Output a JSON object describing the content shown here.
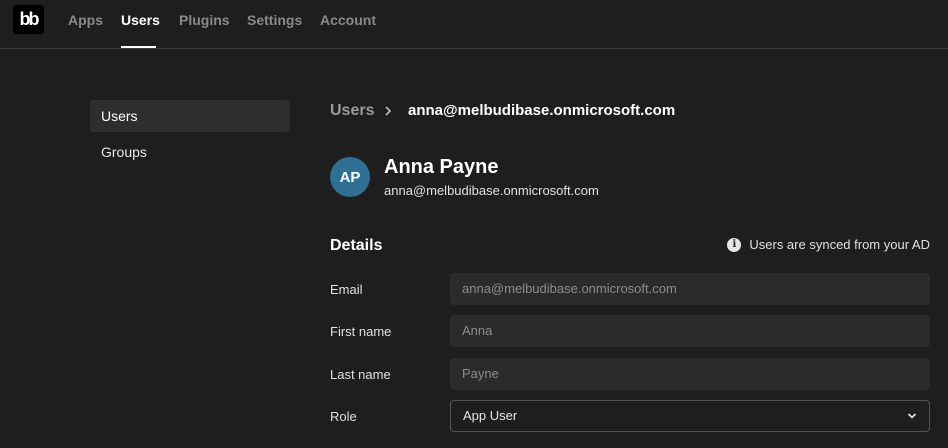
{
  "app": {
    "logo_text": "bb"
  },
  "nav": {
    "items": [
      {
        "label": "Apps",
        "active": false
      },
      {
        "label": "Users",
        "active": true
      },
      {
        "label": "Plugins",
        "active": false
      },
      {
        "label": "Settings",
        "active": false
      },
      {
        "label": "Account",
        "active": false
      }
    ]
  },
  "sidebar": {
    "items": [
      {
        "label": "Users",
        "selected": true
      },
      {
        "label": "Groups",
        "selected": false
      }
    ]
  },
  "breadcrumb": {
    "root": "Users",
    "current": "anna@melbudibase.onmicrosoft.com",
    "separator_icon": "chevron-right-icon"
  },
  "profile": {
    "initials": "AP",
    "name": "Anna Payne",
    "email": "anna@melbudibase.onmicrosoft.com",
    "avatar_color": "#2f6f94"
  },
  "details": {
    "title": "Details",
    "sync_note": "Users are synced from your AD",
    "sync_icon": "info-icon",
    "fields": {
      "email": {
        "label": "Email",
        "value": "anna@melbudibase.onmicrosoft.com"
      },
      "first_name": {
        "label": "First name",
        "value": "Anna"
      },
      "last_name": {
        "label": "Last name",
        "value": "Payne"
      },
      "role": {
        "label": "Role",
        "value": "App User",
        "icon": "chevron-down-icon"
      }
    }
  }
}
